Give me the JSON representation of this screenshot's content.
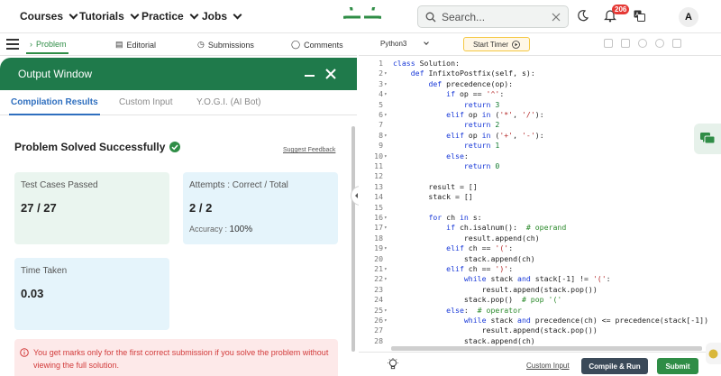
{
  "nav": {
    "items": [
      {
        "label": "Courses"
      },
      {
        "label": "Tutorials"
      },
      {
        "label": "Practice"
      },
      {
        "label": "Jobs"
      }
    ],
    "search_placeholder": "Search...",
    "notification_count": "206",
    "avatar_initial": "A",
    "brand_color": "#2f8d46"
  },
  "left_tabs": {
    "problem": "Problem",
    "editorial": "Editorial",
    "submissions": "Submissions",
    "comments": "Comments"
  },
  "output": {
    "title": "Output Window",
    "tabs": [
      "Compilation Results",
      "Custom Input",
      "Y.O.G.I. (AI Bot)"
    ],
    "status": "Problem Solved Successfully",
    "feedback_link": "Suggest Feedback",
    "cards": {
      "tests_label": "Test Cases Passed",
      "tests_value": "27 / 27",
      "attempts_label": "Attempts : Correct / Total",
      "attempts_value": "2 / 2",
      "accuracy_label": "Accuracy :",
      "accuracy_value": "100%",
      "time_label": "Time Taken",
      "time_value": "0.03"
    },
    "warning": "You get marks only for the first correct submission if you solve the problem without viewing the full solution."
  },
  "editor": {
    "language": "Python3",
    "timer_label": "Start Timer",
    "custom_input": "Custom Input",
    "compile_label": "Compile & Run",
    "submit_label": "Submit",
    "lines": [
      {
        "n": "1",
        "fold": "",
        "html": "<span class='kw'>class</span> Solution:"
      },
      {
        "n": "2",
        "fold": "▾",
        "html": "    <span class='kw'>def</span> InfixtoPostfix(self, s):"
      },
      {
        "n": "3",
        "fold": "▾",
        "html": "        <span class='kw'>def</span> precedence(op):"
      },
      {
        "n": "4",
        "fold": "▾",
        "html": "            <span class='kw'>if</span> op == <span class='st'>'^'</span>:"
      },
      {
        "n": "5",
        "fold": "",
        "html": "                <span class='kw'>return</span> <span class='nm'>3</span>"
      },
      {
        "n": "6",
        "fold": "▾",
        "html": "            <span class='kw'>elif</span> op <span class='kw'>in</span> (<span class='st'>'*'</span>, <span class='st'>'/'</span>):"
      },
      {
        "n": "7",
        "fold": "",
        "html": "                <span class='kw'>return</span> <span class='nm'>2</span>"
      },
      {
        "n": "8",
        "fold": "▾",
        "html": "            <span class='kw'>elif</span> op <span class='kw'>in</span> (<span class='st'>'+'</span>, <span class='st'>'-'</span>):"
      },
      {
        "n": "9",
        "fold": "",
        "html": "                <span class='kw'>return</span> <span class='nm'>1</span>"
      },
      {
        "n": "10",
        "fold": "▾",
        "html": "            <span class='kw'>else</span>:"
      },
      {
        "n": "11",
        "fold": "",
        "html": "                <span class='kw'>return</span> <span class='nm'>0</span>"
      },
      {
        "n": "12",
        "fold": "",
        "html": ""
      },
      {
        "n": "13",
        "fold": "",
        "html": "        result = []"
      },
      {
        "n": "14",
        "fold": "",
        "html": "        stack = []"
      },
      {
        "n": "15",
        "fold": "",
        "html": ""
      },
      {
        "n": "16",
        "fold": "▾",
        "html": "        <span class='kw'>for</span> ch <span class='kw'>in</span> s:"
      },
      {
        "n": "17",
        "fold": "▾",
        "html": "            <span class='kw'>if</span> ch.isalnum():  <span class='cm'># operand</span>"
      },
      {
        "n": "18",
        "fold": "",
        "html": "                result.append(ch)"
      },
      {
        "n": "19",
        "fold": "▾",
        "html": "            <span class='kw'>elif</span> ch == <span class='st'>'('</span>:"
      },
      {
        "n": "20",
        "fold": "",
        "html": "                stack.append(ch)"
      },
      {
        "n": "21",
        "fold": "▾",
        "html": "            <span class='kw'>elif</span> ch == <span class='st'>')'</span>:"
      },
      {
        "n": "22",
        "fold": "▾",
        "html": "                <span class='kw'>while</span> stack <span class='kw'>and</span> stack[-1] != <span class='st'>'('</span>:"
      },
      {
        "n": "23",
        "fold": "",
        "html": "                    result.append(stack.pop())"
      },
      {
        "n": "24",
        "fold": "",
        "html": "                stack.pop()  <span class='cm'># pop '('</span>"
      },
      {
        "n": "25",
        "fold": "▾",
        "html": "            <span class='kw'>else</span>:  <span class='cm'># operator</span>"
      },
      {
        "n": "26",
        "fold": "▾",
        "html": "                <span class='kw'>while</span> stack <span class='kw'>and</span> precedence(ch) &lt;= precedence(stack[-1])"
      },
      {
        "n": "27",
        "fold": "",
        "html": "                    result.append(stack.pop())"
      },
      {
        "n": "28",
        "fold": "",
        "html": "                stack.append(ch)"
      }
    ]
  }
}
